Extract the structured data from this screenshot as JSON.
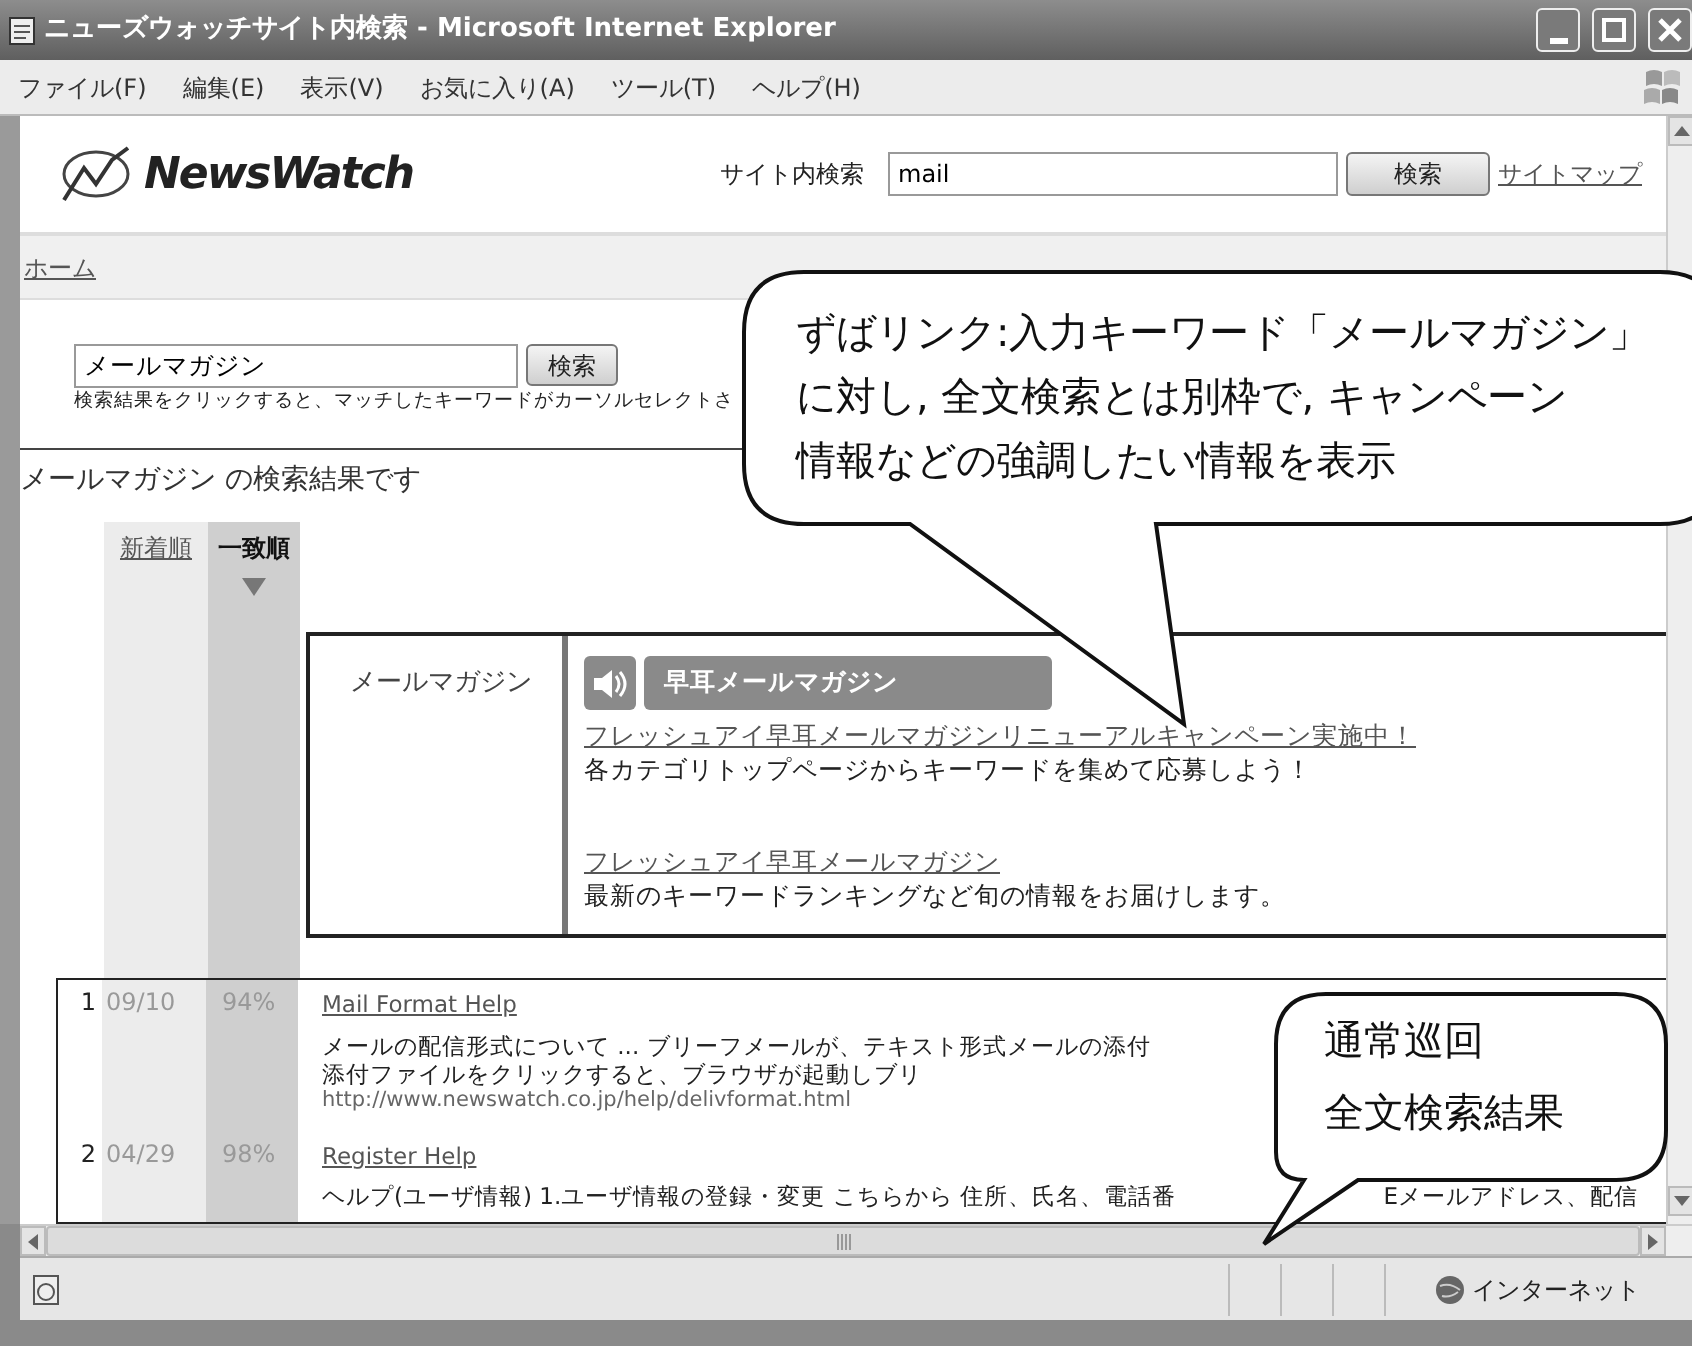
{
  "window": {
    "title": "ニューズウォッチサイト内検索 - Microsoft Internet Explorer"
  },
  "menu": [
    "ファイル(F)",
    "編集(E)",
    "表示(V)",
    "お気に入り(A)",
    "ツール(T)",
    "ヘルプ(H)"
  ],
  "header": {
    "logo": "NewsWatch",
    "search_label": "サイト内検索",
    "search_value": "mail",
    "search_button": "検索",
    "sitemap_link": "サイトマップ"
  },
  "breadcrumb": [
    "ホーム"
  ],
  "search": {
    "value": "メールマガジン",
    "button": "検索",
    "hint": "検索結果をクリックすると、マッチしたキーワードがカーソルセレクトさ"
  },
  "results_heading": "メールマガジン の検索結果です",
  "sort": [
    {
      "label": "新着順",
      "selected": false
    },
    {
      "label": "一致順",
      "selected": true
    }
  ],
  "zubalink": {
    "keyword": "メールマガジン",
    "tag": "早耳メールマガジン",
    "items": [
      {
        "link": "フレッシュアイ早耳メールマガジンリニューアルキャンペーン実施中！",
        "text": "各カテゴリトップページからキーワードを集めて応募しよう！"
      },
      {
        "link": "フレッシュアイ早耳メールマガジン",
        "text": "最新のキーワードランキングなど旬の情報をお届けします。"
      }
    ]
  },
  "results": [
    {
      "number": "1",
      "date": "09/10",
      "score": "94%",
      "title": "Mail Format Help",
      "lines": [
        [
          "メールの配信形式について ... ブリーフメールが、テキスト形式メールの添付"
        ],
        [
          "添付ファイルをクリックすると、ブラウザが起動しブリ"
        ]
      ],
      "url": "http://www.newswatch.co.jp/help/delivformat.html"
    },
    {
      "number": "2",
      "date": "04/29",
      "score": "98%",
      "title": "Register Help",
      "lines": [
        [
          "ヘルプ(ユーザ情報) 1.ユーザ情報の登録・変更 こちらから 住所、氏名、電話番",
          "Eメールアドレス、配信"
        ]
      ]
    }
  ],
  "status_bar": {
    "zone": "インターネット"
  },
  "callouts": [
    {
      "lines": [
        "ずばリンク:入力キーワード「メールマガジン」",
        "に対し, 全文検索とは別枠で, キャンペーン",
        "情報などの強調したい情報を表示"
      ]
    },
    {
      "lines": [
        "通常巡回",
        "全文検索結果"
      ]
    }
  ]
}
